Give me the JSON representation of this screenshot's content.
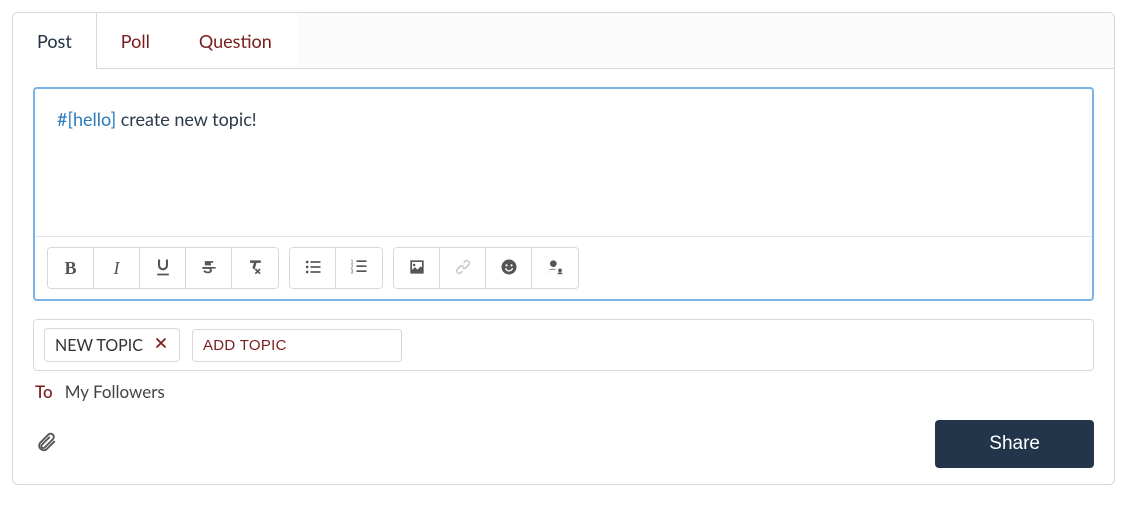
{
  "tabs": {
    "post": "Post",
    "poll": "Poll",
    "question": "Question"
  },
  "editor": {
    "hashtag": "#[hello]",
    "text": " create new topic!"
  },
  "topics": {
    "chip": "NEW TOPIC",
    "add_placeholder": "ADD TOPIC"
  },
  "recipients": {
    "label": "To",
    "value": "My Followers"
  },
  "actions": {
    "share": "Share"
  }
}
